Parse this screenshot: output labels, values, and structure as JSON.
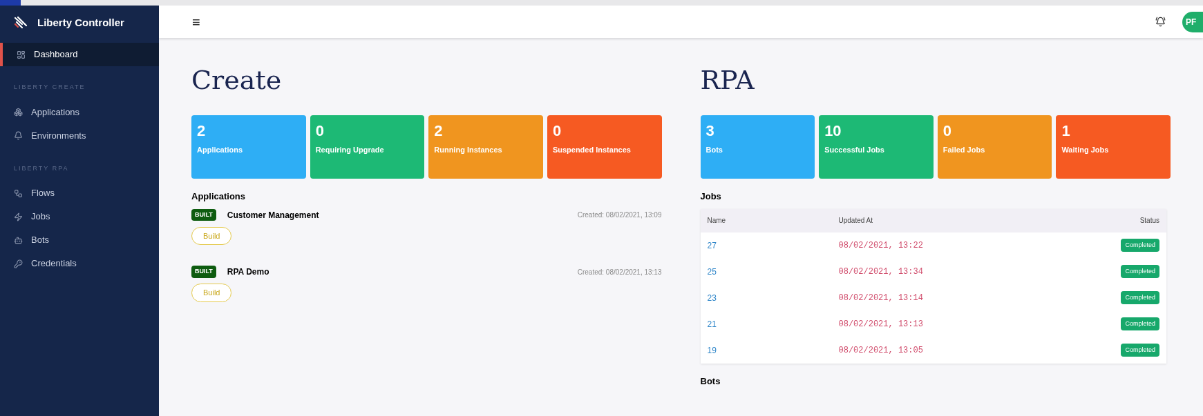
{
  "sidebar": {
    "brand": "Liberty Controller",
    "items": [
      {
        "label": "Dashboard",
        "kind": "dashboard",
        "selected": true
      }
    ],
    "sections": [
      {
        "title": "LIBERTY CREATE",
        "items": [
          {
            "label": "Applications",
            "kind": "apps",
            "selected": false
          },
          {
            "label": "Environments",
            "kind": "env",
            "selected": false
          }
        ]
      },
      {
        "title": "LIBERTY RPA",
        "items": [
          {
            "label": "Flows",
            "kind": "flows",
            "selected": false
          },
          {
            "label": "Jobs",
            "kind": "jobs",
            "selected": false
          },
          {
            "label": "Bots",
            "kind": "bots",
            "selected": false
          },
          {
            "label": "Credentials",
            "kind": "key",
            "selected": false
          }
        ]
      }
    ]
  },
  "header": {
    "menu": "≡",
    "avatar": "PF"
  },
  "create": {
    "title": "Create",
    "stats": [
      {
        "value": "2",
        "label": "Applications",
        "color": "#2eaef5"
      },
      {
        "value": "0",
        "label": "Requiring Upgrade",
        "color": "#1db975"
      },
      {
        "value": "2",
        "label": "Running Instances",
        "color": "#f0951f"
      },
      {
        "value": "0",
        "label": "Suspended Instances",
        "color": "#f65a22"
      }
    ],
    "applications_title": "Applications",
    "applications": [
      {
        "badge": "BUILT",
        "name": "Customer Management",
        "created": "Created: 08/02/2021, 13:09",
        "button": "Build"
      },
      {
        "badge": "BUILT",
        "name": "RPA Demo",
        "created": "Created: 08/02/2021, 13:13",
        "button": "Build"
      }
    ]
  },
  "rpa": {
    "title": "RPA",
    "stats": [
      {
        "value": "3",
        "label": "Bots",
        "color": "#2eaef5"
      },
      {
        "value": "10",
        "label": "Successful Jobs",
        "color": "#1db975"
      },
      {
        "value": "0",
        "label": "Failed Jobs",
        "color": "#f0951f"
      },
      {
        "value": "1",
        "label": "Waiting Jobs",
        "color": "#f65a22"
      }
    ],
    "jobs_title": "Jobs",
    "jobs": {
      "columns": [
        "Name",
        "Updated At",
        "Status"
      ],
      "rows": [
        {
          "name": "27",
          "updated": "08/02/2021, 13:22",
          "status": "Completed"
        },
        {
          "name": "25",
          "updated": "08/02/2021, 13:34",
          "status": "Completed"
        },
        {
          "name": "23",
          "updated": "08/02/2021, 13:14",
          "status": "Completed"
        },
        {
          "name": "21",
          "updated": "08/02/2021, 13:13",
          "status": "Completed"
        },
        {
          "name": "19",
          "updated": "08/02/2021, 13:05",
          "status": "Completed"
        }
      ]
    },
    "bots_title": "Bots"
  }
}
